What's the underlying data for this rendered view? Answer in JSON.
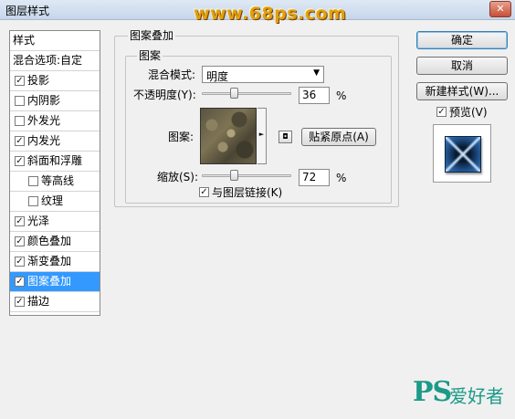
{
  "window": {
    "title": "图层样式",
    "close": "✕"
  },
  "watermark": "www.68ps.com",
  "style_list": {
    "header": "样式",
    "blend_options": "混合选项:自定",
    "items": [
      {
        "label": "投影",
        "checked": true
      },
      {
        "label": "内阴影",
        "checked": false
      },
      {
        "label": "外发光",
        "checked": false
      },
      {
        "label": "内发光",
        "checked": true
      },
      {
        "label": "斜面和浮雕",
        "checked": true
      },
      {
        "label": "等高线",
        "checked": false
      },
      {
        "label": "纹理",
        "checked": false
      },
      {
        "label": "光泽",
        "checked": true
      },
      {
        "label": "颜色叠加",
        "checked": true
      },
      {
        "label": "渐变叠加",
        "checked": true
      },
      {
        "label": "图案叠加",
        "checked": true,
        "selected": true
      },
      {
        "label": "描边",
        "checked": true
      }
    ]
  },
  "panel": {
    "group_title": "图案叠加",
    "sub_group_title": "图案",
    "blend_mode_label": "混合模式:",
    "blend_mode_value": "明度",
    "opacity_label": "不透明度(Y):",
    "opacity_value": "36",
    "opacity_unit": "%",
    "opacity_fraction": 0.36,
    "pattern_label": "图案:",
    "snap_button": "贴紧原点(A)",
    "scale_label": "缩放(S):",
    "scale_value": "72",
    "scale_unit": "%",
    "link_checkbox": "与图层链接(K)",
    "link_checked": true
  },
  "buttons": {
    "ok": "确定",
    "cancel": "取消",
    "new_style": "新建样式(W)...",
    "preview_label": "预览(V)",
    "preview_checked": true
  },
  "brand": {
    "main": "PS",
    "sub": "爱好者"
  },
  "icons": {
    "check": "☑",
    "dropdown_arrow": "▼",
    "pattern_arrow": "►",
    "new_preset": "◘"
  }
}
